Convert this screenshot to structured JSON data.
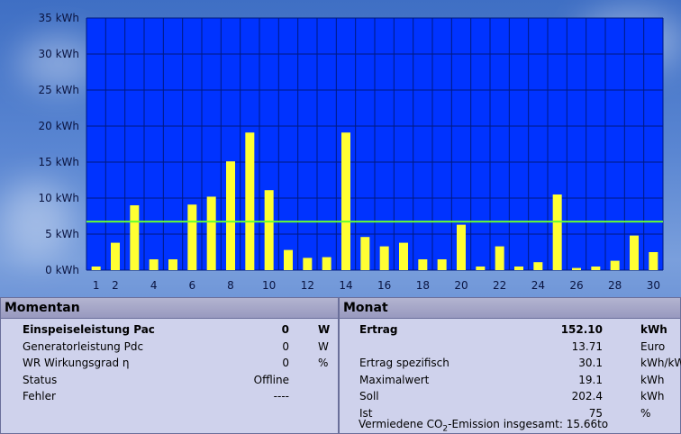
{
  "chart_data": {
    "type": "bar",
    "x": [
      1,
      2,
      3,
      4,
      5,
      6,
      7,
      8,
      9,
      10,
      11,
      12,
      13,
      14,
      15,
      16,
      17,
      18,
      19,
      20,
      21,
      22,
      23,
      24,
      25,
      26,
      27,
      28,
      29,
      30
    ],
    "x_tick_labels": [
      "1",
      "2",
      "4",
      "6",
      "8",
      "10",
      "12",
      "14",
      "16",
      "18",
      "20",
      "22",
      "24",
      "26",
      "28",
      "30"
    ],
    "values": [
      0.5,
      3.8,
      9.0,
      1.5,
      1.5,
      9.1,
      10.2,
      15.1,
      19.1,
      11.1,
      2.8,
      1.7,
      1.8,
      19.1,
      4.6,
      3.3,
      3.8,
      1.5,
      1.5,
      6.3,
      0.5,
      3.3,
      0.5,
      1.1,
      10.5,
      0.3,
      0.5,
      1.3,
      4.8,
      2.5
    ],
    "y_tick_labels": [
      "0 kWh",
      "5 kWh",
      "10 kWh",
      "15 kWh",
      "20 kWh",
      "25 kWh",
      "30 kWh",
      "35 kWh"
    ],
    "ylim": [
      0,
      35
    ],
    "reference_line": 6.74,
    "grid": true,
    "colors": {
      "plot_bg": "#0033ff",
      "bar": "#ffff33",
      "grid": "#001a80",
      "reference": "#66ff33"
    }
  },
  "momentan": {
    "title": "Momentan",
    "rows": [
      {
        "label": "Einspeiseleistung Pac",
        "value": "0",
        "unit": "W"
      },
      {
        "label": "Generatorleistung Pdc",
        "value": "0",
        "unit": "W"
      },
      {
        "label": "WR Wirkungsgrad η",
        "value": "0",
        "unit": "%"
      },
      {
        "label": "Status",
        "value": "Offline",
        "unit": ""
      },
      {
        "label": "Fehler",
        "value": "----",
        "unit": ""
      }
    ]
  },
  "monat": {
    "title": "Monat",
    "rows": [
      {
        "label": "Ertrag",
        "value": "152.10",
        "unit": "kWh"
      },
      {
        "label": "",
        "value": "13.71",
        "unit": "Euro"
      },
      {
        "label": "Ertrag spezifisch",
        "value": "30.1",
        "unit": "kWh/kWp"
      },
      {
        "label": "Maximalwert",
        "value": "19.1",
        "unit": "kWh"
      },
      {
        "label": "Soll",
        "value": "202.4",
        "unit": "kWh"
      },
      {
        "label": "Ist",
        "value": "75",
        "unit": "%"
      }
    ]
  },
  "co2": {
    "prefix": "Vermiedene CO",
    "sub": "2",
    "suffix": "-Emission insgesamt: 15.66to"
  }
}
